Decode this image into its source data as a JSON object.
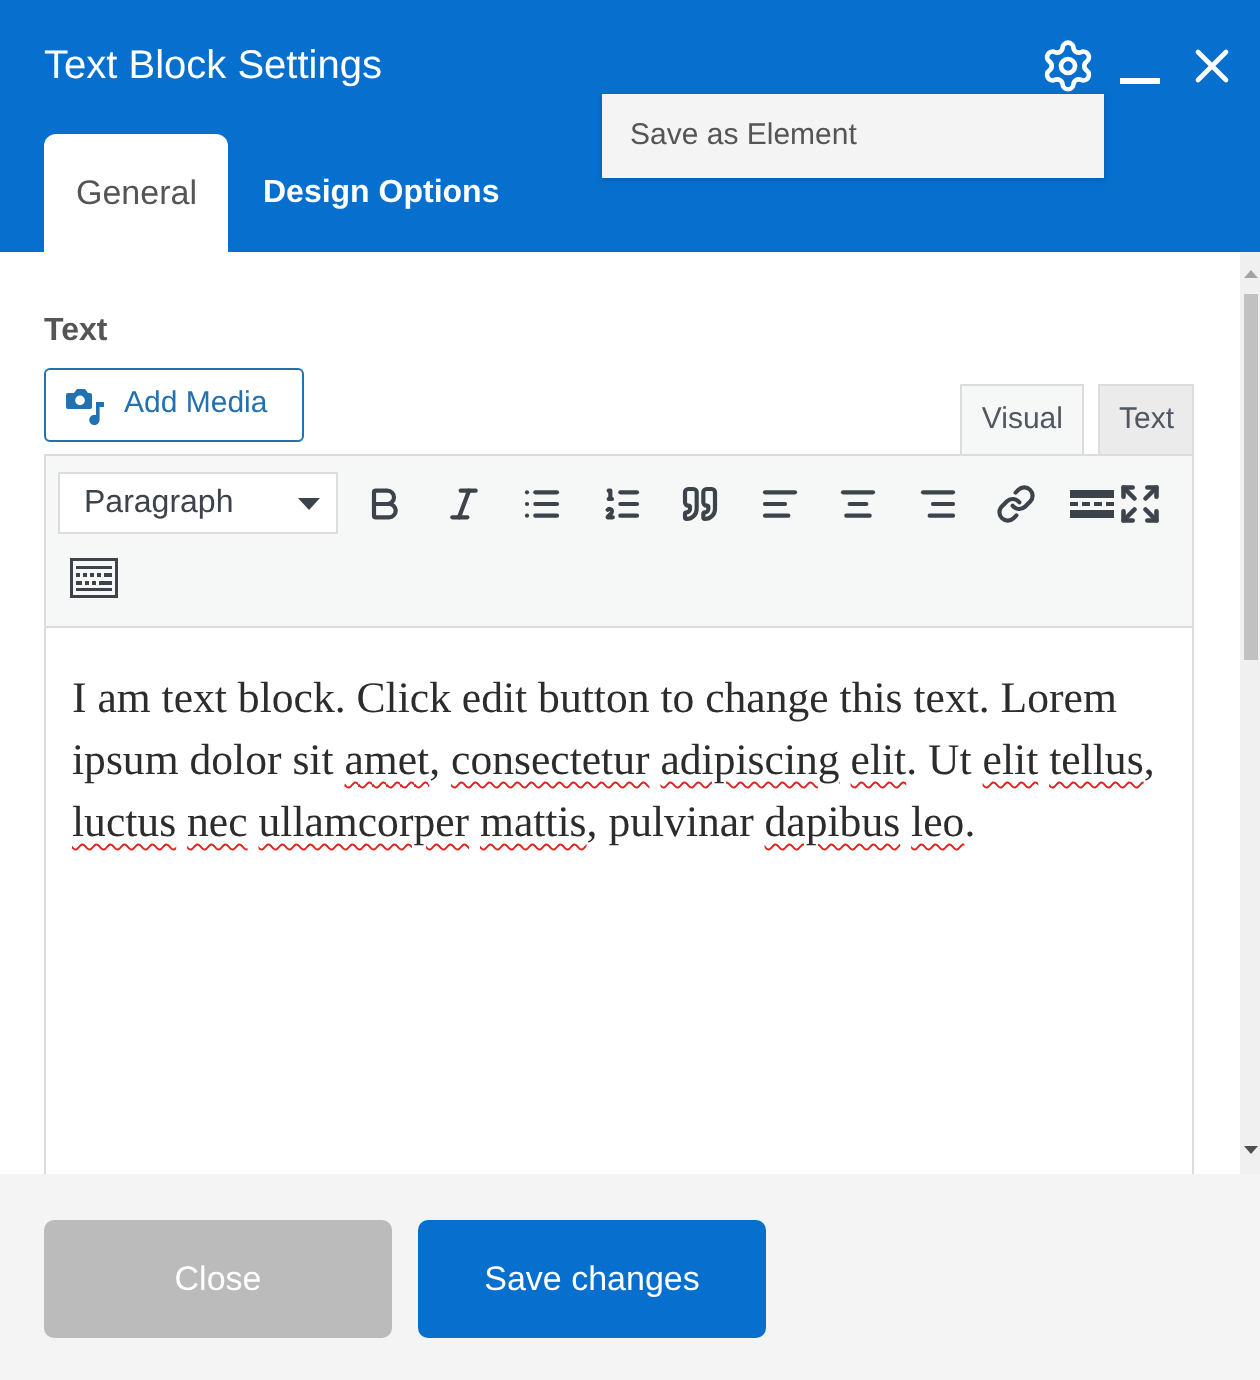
{
  "window": {
    "title": "Text Block Settings"
  },
  "menu": {
    "items": [
      {
        "label": "Save as Element"
      }
    ]
  },
  "tabs": [
    {
      "label": "General",
      "selected": true
    },
    {
      "label": "Design Options",
      "selected": false
    }
  ],
  "text_field": {
    "label": "Text",
    "add_media": "Add Media",
    "editor_tabs": [
      {
        "label": "Visual",
        "selected": true
      },
      {
        "label": "Text",
        "selected": false
      }
    ],
    "format": "Paragraph",
    "content": [
      {
        "text": "I am text block. Click edit button to change this text. Lorem ipsum dolor sit",
        "misspelled": false
      },
      {
        "text": "amet",
        "misspelled": true,
        "punctuation": ","
      },
      {
        "text": "consectetur",
        "misspelled": true
      },
      {
        "text": "adipiscing",
        "misspelled": true
      },
      {
        "text": "elit",
        "misspelled": true,
        "punctuation": "."
      },
      {
        "text": "Ut",
        "misspelled": false
      },
      {
        "text": "elit",
        "misspelled": true
      },
      {
        "text": "tellus",
        "misspelled": true,
        "punctuation": ","
      },
      {
        "text": "luctus",
        "misspelled": true
      },
      {
        "text": "nec",
        "misspelled": true
      },
      {
        "text": "ullamcorper",
        "misspelled": true
      },
      {
        "text": "mattis",
        "misspelled": true,
        "punctuation": ","
      },
      {
        "text": "pulvinar",
        "misspelled": false
      },
      {
        "text": "dapibus",
        "misspelled": true
      },
      {
        "text": "leo",
        "misspelled": true,
        "punctuation": "."
      }
    ]
  },
  "buttons": [
    {
      "label": "Close",
      "kind": "secondary"
    },
    {
      "label": "Save changes",
      "kind": "primary"
    }
  ]
}
